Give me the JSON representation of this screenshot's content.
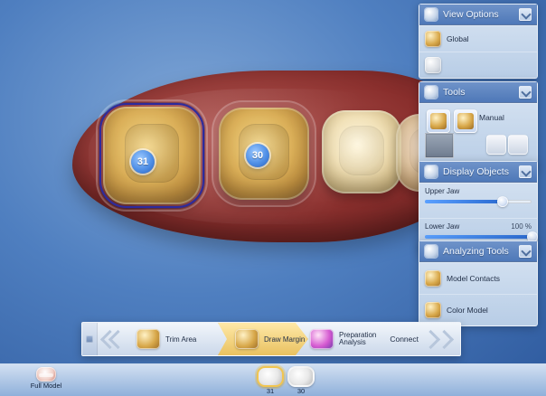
{
  "panels": {
    "view_options": {
      "title": "View Options",
      "items": [
        {
          "label": "Global"
        }
      ]
    },
    "tools": {
      "title": "Tools",
      "primary_label": "Manual"
    },
    "display_objects": {
      "title": "Display Objects",
      "rows": [
        {
          "name": "Upper Jaw",
          "percent_text": "",
          "value": 0.72
        },
        {
          "name": "Lower Jaw",
          "percent_text": "100 %",
          "value": 1.0
        }
      ]
    },
    "analyzing_tools": {
      "title": "Analyzing Tools",
      "items": [
        {
          "label": "Model Contacts"
        },
        {
          "label": "Color Model"
        }
      ]
    }
  },
  "workflow": {
    "steps": [
      {
        "label": "Trim Area"
      },
      {
        "label": "Draw Margin"
      },
      {
        "label": "Preparation Analysis"
      }
    ],
    "connect_label": "Connect"
  },
  "bottom_bar": {
    "full_model_label": "Full Model",
    "tooth_thumbs": [
      {
        "label": "31",
        "active": true
      },
      {
        "label": "30",
        "active": false
      }
    ]
  },
  "model_badges": [
    {
      "label": "31"
    },
    {
      "label": "30"
    }
  ],
  "colors": {
    "accent_blue": "#4f78b8",
    "margin_outline": "#2d2a9e",
    "active_step": "#e9c160"
  }
}
